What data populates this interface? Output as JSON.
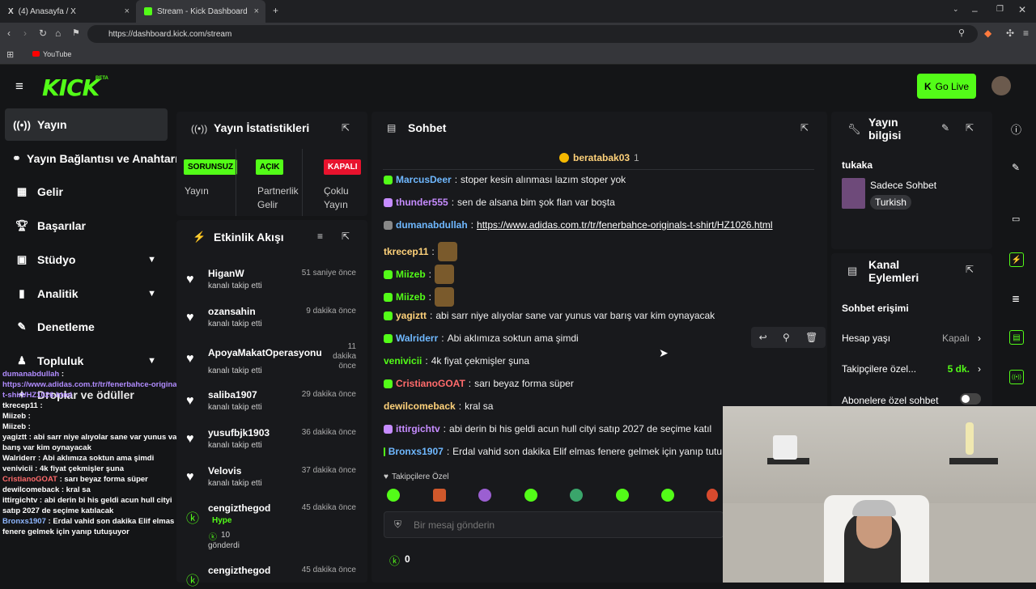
{
  "browser": {
    "tabs": [
      {
        "label": "(4) Anasayfa / X"
      },
      {
        "label": "Stream - Kick Dashboard"
      }
    ],
    "url": "https://dashboard.kick.com/stream",
    "bookmark": "YouTube"
  },
  "header": {
    "logo": "KICK",
    "beta": "BETA",
    "go_live": "Go Live"
  },
  "sidebar": {
    "items": [
      {
        "label": "Yayın"
      },
      {
        "label": "Yayın Bağlantısı ve Anahtarı"
      },
      {
        "label": "Gelir"
      },
      {
        "label": "Başarılar"
      },
      {
        "label": "Stüdyo"
      },
      {
        "label": "Analitik"
      },
      {
        "label": "Denetleme"
      },
      {
        "label": "Topluluk"
      },
      {
        "label": "Droplar ve ödüller"
      }
    ]
  },
  "overlay_chat": [
    {
      "user": "dumanabdullah",
      "text": ":",
      "color": "#b18cff"
    },
    {
      "user": "",
      "text": "https://www.adidas.com.tr/tr/fenerbahce-originals-t-shirt/HZ1026.html",
      "color": "#b18cff"
    },
    {
      "user": "tkrecep11",
      "text": ":",
      "color": "#ffffff"
    },
    {
      "user": "Miizeb",
      "text": ":",
      "color": "#ffffff"
    },
    {
      "user": "Miizeb",
      "text": ":",
      "color": "#ffffff"
    },
    {
      "user": "yagiztt",
      "text": ": abi sarr niye alıyolar sane var yunus var barış var kim oynayacak",
      "color": "#ffffff"
    },
    {
      "user": "Walriderr",
      "text": ": Abi aklımıza soktun ama şimdi",
      "color": "#ffffff"
    },
    {
      "user": "venivicii",
      "text": ": 4k fiyat çekmişler şuna",
      "color": "#ffffff"
    },
    {
      "user": "CristianoGOAT",
      "text": ": sarı beyaz forma süper",
      "color": "#ff6b6b"
    },
    {
      "user": "dewilcomeback",
      "text": ": kral sa",
      "color": "#ffffff"
    },
    {
      "user": "ittirgichtv",
      "text": ": abi derin bi his geldi acun hull cityi satıp 2027 de seçime katılacak",
      "color": "#ffffff"
    },
    {
      "user": "Bronxs1907",
      "text": ": Erdal vahid son dakika Elif elmas fenere gelmek için yanıp tutuşuyor",
      "color": "#8fb7ff"
    }
  ],
  "stats": {
    "title": "Yayın İstatistikleri",
    "items": [
      {
        "badge": "SORUNSUZ",
        "label": "Yayın"
      },
      {
        "badge": "AÇIK",
        "label": "Partnerlik Gelir"
      },
      {
        "badge": "KAPALI",
        "label": "Çoklu Yayın"
      }
    ]
  },
  "activity": {
    "title": "Etkinlik Akışı",
    "items": [
      {
        "name": "HiganW",
        "sub": "kanalı takip etti",
        "time": "51 saniye önce"
      },
      {
        "name": "ozansahin",
        "sub": "kanalı takip etti",
        "time": "9 dakika önce"
      },
      {
        "name": "ApoyaMakatOperasyonu",
        "sub": "kanalı takip etti",
        "time": "11 dakika önce"
      },
      {
        "name": "saliba1907",
        "sub": "kanalı takip etti",
        "time": "29 dakika önce"
      },
      {
        "name": "yusufbjk1903",
        "sub": "kanalı takip etti",
        "time": "36 dakika önce"
      },
      {
        "name": "Velovis",
        "sub": "kanalı takip etti",
        "time": "37 dakika önce"
      },
      {
        "name": "cengizthegod",
        "hype": "Hype",
        "count": "10",
        "sub2": "gönderdi",
        "time": "45 dakika önce"
      },
      {
        "name": "cengizthegod",
        "time": "45 dakika önce"
      }
    ]
  },
  "chat": {
    "title": "Sohbet",
    "pinned_user": "beratabak03",
    "pinned_count": "1",
    "messages": [
      {
        "user": "MarcusDeer",
        "text": "stoper kesin alınması lazım stoper yok",
        "color": "#6fb8ff"
      },
      {
        "user": "thunder555",
        "text": "sen de alsana bim şok flan var boşta",
        "color": "#c68cff"
      },
      {
        "user": "dumanabdullah",
        "text": "https://www.adidas.com.tr/tr/fenerbahce-originals-t-shirt/HZ1026.html",
        "color": "#6fb8ff"
      },
      {
        "user": "tkrecep11",
        "text": "",
        "color": "#ffd27a"
      },
      {
        "user": "Miizeb",
        "text": "",
        "color": "#53fc18"
      },
      {
        "user": "Miizeb",
        "text": "",
        "color": "#53fc18"
      },
      {
        "user": "yagiztt",
        "text": "abi sarr niye alıyolar sane var yunus var barış var kim oynayacak",
        "color": "#ffd27a"
      },
      {
        "user": "Walriderr",
        "text": "Abi aklımıza soktun ama şimdi",
        "color": "#6fb8ff"
      },
      {
        "user": "venivicii",
        "text": "4k fiyat çekmişler şuna",
        "color": "#53fc18"
      },
      {
        "user": "CristianoGOAT",
        "text": "sarı beyaz forma süper",
        "color": "#ff6b6b"
      },
      {
        "user": "dewilcomeback",
        "text": "kral sa",
        "color": "#ffd27a"
      },
      {
        "user": "ittirgichtv",
        "text": "abi derin bi his geldi acun hull cityi satıp 2027 de seçime katıl",
        "color": "#c68cff"
      },
      {
        "user": "Bronxs1907",
        "text": "Erdal vahid son dakika Elif elmas fenere gelmek için yanıp tutu",
        "color": "#6fb8ff"
      }
    ],
    "emote_label": "Takipçilere Özel",
    "placeholder": "Bir mesaj gönderin",
    "points": "0"
  },
  "stream_info": {
    "title": "Yayın bilgisi",
    "channel": "tukaka",
    "category": "Sadece Sohbet",
    "language": "Turkish"
  },
  "channel_actions": {
    "title": "Kanal Eylemleri",
    "section": "Sohbet erişimi",
    "rows": [
      {
        "label": "Hesap yaşı",
        "value": "Kapalı"
      },
      {
        "label": "Takipçilere özel...",
        "value": "5 dk."
      },
      {
        "label": "Abonelere özel sohbet",
        "value": ""
      }
    ]
  },
  "colors": {
    "accent": "#53fc18",
    "danger": "#e8122d",
    "panel": "#18191c"
  }
}
